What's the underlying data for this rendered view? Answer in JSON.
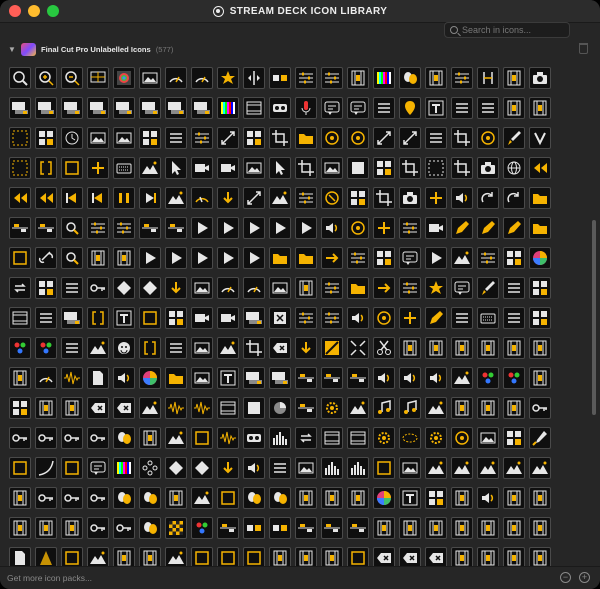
{
  "window": {
    "title": "STREAM DECK ICON LIBRARY",
    "traffic_lights": [
      "close",
      "minimize",
      "maximize"
    ]
  },
  "search": {
    "placeholder": "Search in icons..."
  },
  "pack": {
    "name": "Final Cut Pro Unlabelled Icons",
    "count": "(577)",
    "expanded": true
  },
  "footer": {
    "more_link": "Get more icon packs..."
  },
  "colors": {
    "accent": "#f5b301",
    "tile_border": "#4a4a4a",
    "background": "#262626"
  },
  "icons": [
    "zoom-fit-icon",
    "zoom-in-icon",
    "zoom-out-icon",
    "monitor-grid-icon",
    "color-board-icon",
    "image-icon",
    "meter-icon",
    "meter-icon",
    "star-icon",
    "split-icon",
    "transition-icon",
    "sliders-icon",
    "sliders-icon",
    "film-strip-icon",
    "color-bars-icon",
    "masks-icon",
    "film-strip-icon",
    "sliders-icon",
    "trim-icon",
    "film-strip-icon",
    "camera-icon",
    "clip-icon",
    "clip-icon",
    "clip-icon",
    "clip-icon",
    "clip-icon",
    "clip-icon",
    "clip-icon",
    "clip-icon",
    "color-bars-icon",
    "film-icon",
    "vr-icon",
    "microphone-icon",
    "caption-icon",
    "caption-icon",
    "list-icon",
    "marker-icon",
    "title-icon",
    "list-icon",
    "list-icon",
    "film-strip-icon",
    "film-strip-icon",
    "fullscreen-icon",
    "grid-icon",
    "clock-icon",
    "image-icon",
    "image-icon",
    "grid-icon",
    "list-icon",
    "sliders-icon",
    "transform-icon",
    "grid-icon",
    "crop-icon",
    "folder-icon",
    "target-icon",
    "target-icon",
    "transform-icon",
    "transform-icon",
    "list-icon",
    "crop-icon",
    "target-icon",
    "brush-icon",
    "effects-icon",
    "fullscreen-icon",
    "bracket-icon",
    "box-icon",
    "add-icon",
    "keyboard-icon",
    "mountain-icon",
    "pointer-icon",
    "video-icon",
    "video-icon",
    "image-icon",
    "pointer-icon",
    "crop-icon",
    "image-icon",
    "square-icon",
    "grid-icon",
    "crop-icon",
    "select-icon",
    "crop-icon",
    "camera-icon",
    "globe-icon",
    "rewind-icon",
    "rewind-icon",
    "rewind-icon",
    "back-icon",
    "back-icon",
    "pause-icon",
    "skip-icon",
    "mountain-icon",
    "gauge-icon",
    "down-icon",
    "transform-icon",
    "mountain-icon",
    "sliders-icon",
    "cancel-icon",
    "grid-icon",
    "crop-icon",
    "camera-icon",
    "add-icon",
    "audio-icon",
    "redo-icon",
    "redo-icon",
    "folder-icon",
    "timeline-icon",
    "timeline-icon",
    "zoom-icon",
    "sliders-icon",
    "sliders-icon",
    "timeline-icon",
    "timeline-icon",
    "play-icon",
    "play-icon",
    "play-icon",
    "play-icon",
    "play-icon",
    "audio-icon",
    "target-icon",
    "add-icon",
    "sliders-icon",
    "video-icon",
    "pen-icon",
    "pen-icon",
    "pen-icon",
    "folder-icon",
    "box-icon",
    "link-icon",
    "zoom-icon",
    "film-strip-icon",
    "film-strip-icon",
    "play-icon",
    "play-icon",
    "play-icon",
    "play-icon",
    "play-icon",
    "folder-icon",
    "folder-icon",
    "forward-icon",
    "sliders-icon",
    "grid-icon",
    "caption-icon",
    "play-icon",
    "mountain-icon",
    "sliders-icon",
    "grid-icon",
    "color-wheel-icon",
    "loop-icon",
    "grid-icon",
    "list-icon",
    "key-icon",
    "diamond-icon",
    "diamond-icon",
    "down-icon",
    "image-icon",
    "meter-icon",
    "meter-icon",
    "image-icon",
    "film-strip-icon",
    "sliders-icon",
    "folder-icon",
    "forward-icon",
    "sliders-icon",
    "star-icon",
    "caption-icon",
    "brush-icon",
    "list-icon",
    "grid-icon",
    "film-icon",
    "list-icon",
    "clip-icon",
    "bracket-icon",
    "title-icon",
    "box-icon",
    "grid-icon",
    "video-icon",
    "video-icon",
    "clip-icon",
    "close-icon",
    "sliders-icon",
    "sliders-icon",
    "audio-icon",
    "target-icon",
    "add-icon",
    "pen-icon",
    "list-icon",
    "keyboard-icon",
    "list-icon",
    "grid-icon",
    "color-dots-icon",
    "color-dots-icon",
    "list-icon",
    "mountain-icon",
    "smile-icon",
    "bracket-icon",
    "list-icon",
    "image-icon",
    "mountain-icon",
    "crop-icon",
    "delete-icon",
    "down-icon",
    "slash-icon",
    "expand-icon",
    "scissors-icon",
    "film-strip-icon",
    "film-strip-icon",
    "film-strip-icon",
    "film-strip-icon",
    "film-strip-icon",
    "film-strip-icon",
    "film-strip-icon",
    "meter-icon",
    "waveform-icon",
    "page-icon",
    "audio-icon",
    "color-wheel-icon",
    "folder-icon",
    "image-icon",
    "title-icon",
    "clip-icon",
    "clip-icon",
    "timeline-icon",
    "timeline-icon",
    "timeline-icon",
    "audio-icon",
    "audio-icon",
    "audio-icon",
    "mountain-icon",
    "color-dots-icon",
    "color-dots-icon",
    "film-strip-icon",
    "grid-icon",
    "film-strip-icon",
    "film-strip-icon",
    "delete-icon",
    "delete-icon",
    "mountain-icon",
    "waveform-icon",
    "waveform-icon",
    "film-icon",
    "square-icon",
    "pie-icon",
    "timeline-icon",
    "settings-icon",
    "mountain-icon",
    "music-icon",
    "music-icon",
    "mountain-icon",
    "film-strip-icon",
    "film-strip-icon",
    "film-strip-icon",
    "key-icon",
    "key-icon",
    "key-icon",
    "key-icon",
    "key-icon",
    "masks-icon",
    "film-strip-icon",
    "mountain-icon",
    "box-icon",
    "waveform-icon",
    "vr-icon",
    "bars-icon",
    "loop-icon",
    "film-icon",
    "film-icon",
    "settings-icon",
    "ellipse-icon",
    "settings-icon",
    "target-icon",
    "image-icon",
    "grid-icon",
    "eyedropper-icon",
    "box-icon",
    "curve-icon",
    "box-icon",
    "caption-icon",
    "color-bars-icon",
    "gamepad-icon",
    "diamond-icon",
    "diamond-icon",
    "down-icon",
    "audio-icon",
    "list-icon",
    "image-icon",
    "bars-icon",
    "bars-icon",
    "box-icon",
    "image-icon",
    "mountain-icon",
    "mountain-icon",
    "mountain-icon",
    "mountain-icon",
    "mountain-icon",
    "film-strip-icon",
    "key-icon",
    "key-icon",
    "key-icon",
    "masks-icon",
    "masks-icon",
    "film-strip-icon",
    "mountain-icon",
    "box-icon",
    "masks-icon",
    "masks-icon",
    "film-strip-icon",
    "film-strip-icon",
    "film-strip-icon",
    "color-wheel-icon",
    "title-icon",
    "grid-icon",
    "film-strip-icon",
    "audio-icon",
    "film-strip-icon",
    "film-strip-icon",
    "film-strip-icon",
    "film-strip-icon",
    "film-strip-icon",
    "key-icon",
    "key-icon",
    "masks-icon",
    "checker-icon",
    "color-dots-icon",
    "timeline-icon",
    "transition-icon",
    "transition-icon",
    "timeline-icon",
    "timeline-icon",
    "timeline-icon",
    "film-strip-icon",
    "film-strip-icon",
    "film-strip-icon",
    "film-strip-icon",
    "film-strip-icon",
    "film-strip-icon",
    "film-strip-icon",
    "page-icon",
    "light-icon",
    "box-icon",
    "mountain-icon",
    "film-strip-icon",
    "film-strip-icon",
    "mountain-icon",
    "box-icon",
    "box-icon",
    "box-icon",
    "film-strip-icon",
    "film-strip-icon",
    "film-strip-icon",
    "box-icon",
    "delete-icon",
    "delete-icon",
    "delete-icon",
    "film-strip-icon",
    "film-strip-icon",
    "film-strip-icon",
    "film-strip-icon"
  ]
}
